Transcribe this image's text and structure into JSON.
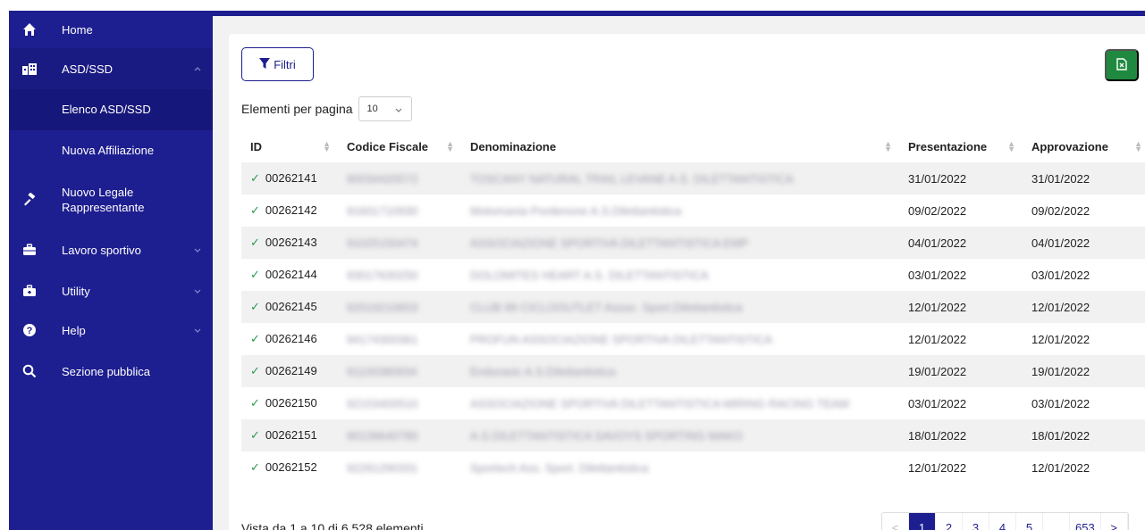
{
  "sidebar": {
    "items": [
      {
        "label": "Home",
        "icon": "home-icon"
      },
      {
        "label": "ASD/SSD",
        "icon": "buildings-icon"
      },
      {
        "label": "Nuovo Legale Rappresentante",
        "icon": "gavel-icon"
      },
      {
        "label": "Lavoro sportivo",
        "icon": "briefcase-icon"
      },
      {
        "label": "Utility",
        "icon": "toolbox-icon"
      },
      {
        "label": "Help",
        "icon": "help-icon"
      },
      {
        "label": "Sezione pubblica",
        "icon": "search-icon"
      }
    ],
    "subitems": [
      {
        "label": "Elenco ASD/SSD"
      },
      {
        "label": "Nuova Affiliazione"
      }
    ]
  },
  "toolbar": {
    "filter_label": "Filtri",
    "perpage_label": "Elementi per pagina",
    "perpage_value": "10"
  },
  "table": {
    "headers": [
      "ID",
      "Codice Fiscale",
      "Denominazione",
      "Presentazione",
      "Approvazione"
    ],
    "rows": [
      {
        "id": "00262141",
        "cf": "90034420572",
        "den": "TOSCANY NATURAL TRAIL LEVANE A.S. DILETTANTISTICA",
        "pres": "31/01/2022",
        "appr": "31/01/2022"
      },
      {
        "id": "00262142",
        "cf": "91601710930",
        "den": "Motomania Pordenone A.S.Dilettantistica",
        "pres": "09/02/2022",
        "appr": "09/02/2022"
      },
      {
        "id": "00262143",
        "cf": "91025150474",
        "den": "ASSOCIAZIONE SPORTIVA DILETTANTISTICA EMP",
        "pres": "04/01/2022",
        "appr": "04/01/2022"
      },
      {
        "id": "00262144",
        "cf": "93017630250",
        "den": "DOLOMITES HEART A.S. DILETTANTISTICA",
        "pres": "03/01/2022",
        "appr": "03/01/2022"
      },
      {
        "id": "00262145",
        "cf": "92019210653",
        "den": "CLUB 99 CICLOOUTLET Assoc. Sport.Dilettantistica",
        "pres": "12/01/2022",
        "appr": "12/01/2022"
      },
      {
        "id": "00262146",
        "cf": "94174300361",
        "den": "PROFUN ASSOCIAZIONE SPORTIVA DILETTANTISTICA",
        "pres": "12/01/2022",
        "appr": "12/01/2022"
      },
      {
        "id": "00262149",
        "cf": "91100380934",
        "den": "Endurasic A.S.Dilettantistica",
        "pres": "19/01/2022",
        "appr": "19/01/2022"
      },
      {
        "id": "00262150",
        "cf": "92153400510",
        "den": "ASSOCIAZIONE SPORTIVA DILETTANTISTICA MIRING RACING TEAM",
        "pres": "03/01/2022",
        "appr": "03/01/2022"
      },
      {
        "id": "00262151",
        "cf": "90139640780",
        "den": "A.S.DILETTANTISTICA SAVOYS SPORTING MAKO",
        "pres": "18/01/2022",
        "appr": "18/01/2022"
      },
      {
        "id": "00262152",
        "cf": "92261290331",
        "den": "Sportech Ass. Sport. Dilettantistica",
        "pres": "12/01/2022",
        "appr": "12/01/2022"
      }
    ]
  },
  "footer": {
    "summary": "Vista da 1 a 10 di 6,528 elementi",
    "pages": [
      "<",
      "1",
      "2",
      "3",
      "4",
      "5",
      "...",
      "653",
      ">"
    ]
  },
  "colors": {
    "brand": "#1d1e8f",
    "success": "#2a9a4a",
    "excel": "#1f8a3f"
  }
}
